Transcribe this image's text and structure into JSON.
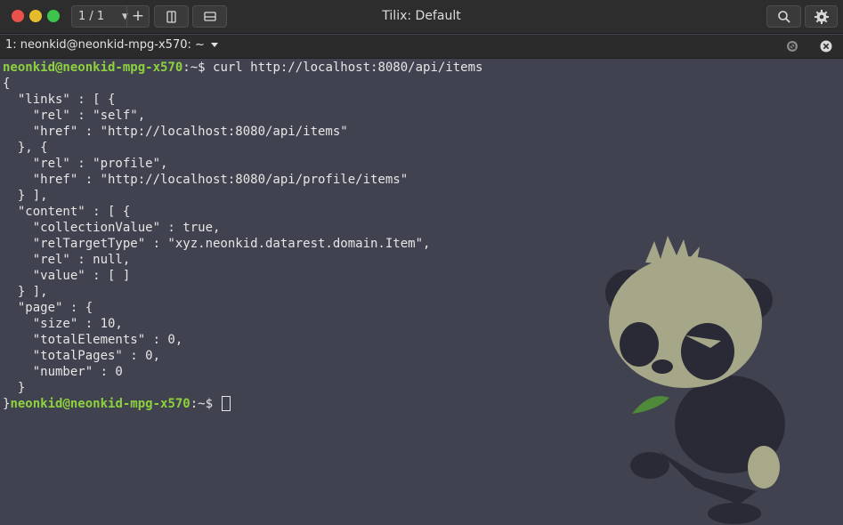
{
  "window": {
    "title": "Tilix: Default",
    "session_counter": "1 / 1",
    "buttons": {
      "add_session": "+"
    }
  },
  "tab": {
    "label": "1: neonkid@neonkid-mpg-x570: ~"
  },
  "terminal": {
    "prompt_user": "neonkid@neonkid-mpg-x570",
    "prompt_tail": ":~$ ",
    "command": "curl http://localhost:8080/api/items",
    "output_lines": [
      "{",
      "  \"links\" : [ {",
      "    \"rel\" : \"self\",",
      "    \"href\" : \"http://localhost:8080/api/items\"",
      "  }, {",
      "    \"rel\" : \"profile\",",
      "    \"href\" : \"http://localhost:8080/api/profile/items\"",
      "  } ],",
      "  \"content\" : [ {",
      "    \"collectionValue\" : true,",
      "    \"relTargetType\" : \"xyz.neonkid.datarest.domain.Item\",",
      "    \"rel\" : null,",
      "    \"value\" : [ ]",
      "  } ],",
      "  \"page\" : {",
      "    \"size\" : 10,",
      "    \"totalElements\" : 0,",
      "    \"totalPages\" : 0,",
      "    \"number\" : 0",
      "  }"
    ],
    "last_line_prefix": "}"
  },
  "colors": {
    "terminal_bg": "#41424f",
    "prompt_user": "#8ed13f",
    "text": "#e6e6e6",
    "titlebar": "#2d2d2d"
  },
  "icons": {
    "close": "close-icon",
    "minimize": "minimize-icon",
    "maximize": "maximize-icon",
    "search": "search-icon",
    "settings": "gear-icon",
    "split_right": "split-right-icon",
    "split_down": "split-down-icon",
    "readonly": "readonly-icon",
    "tab_close": "close-tab-icon"
  }
}
